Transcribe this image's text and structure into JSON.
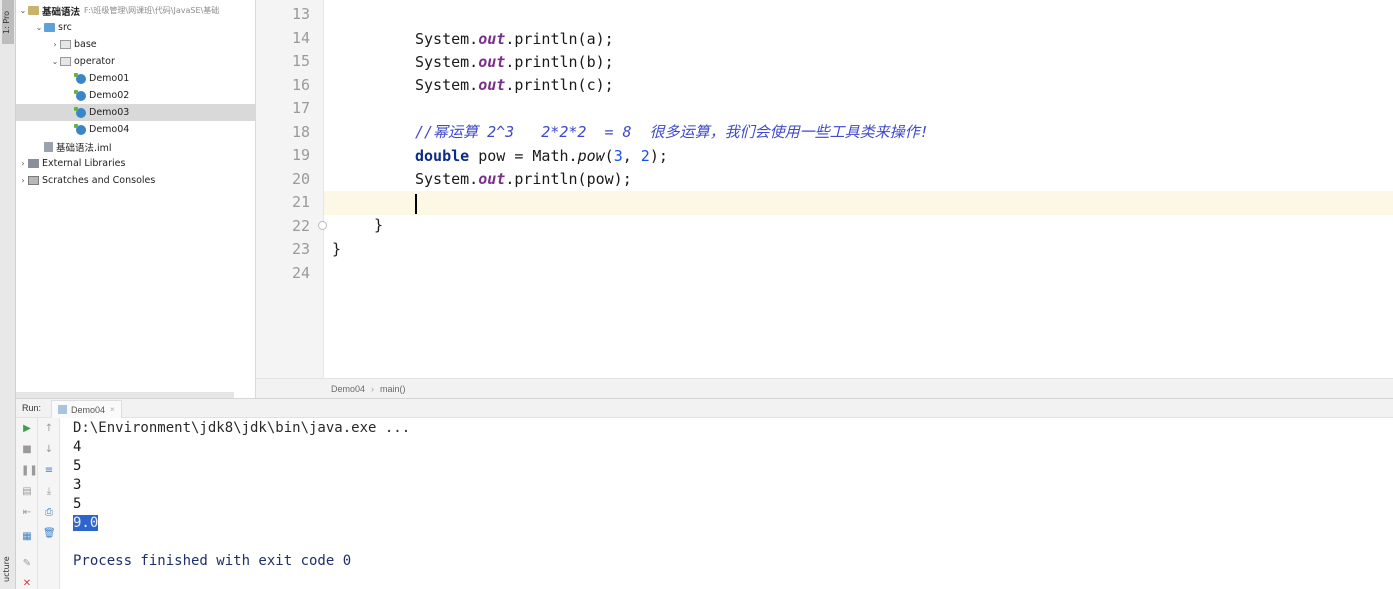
{
  "tool_strip": {
    "top_tab": "1: Pro",
    "bottom_tab": "ucture"
  },
  "project": {
    "items": [
      {
        "label": "基础语法",
        "hint": "F:\\班级管理\\网课班\\代码\\JavaSE\\基础",
        "indent": 0,
        "arrow": "v",
        "icon": "folder"
      },
      {
        "label": "src",
        "indent": 1,
        "arrow": "v",
        "icon": "src"
      },
      {
        "label": "base",
        "indent": 2,
        "arrow": ">",
        "icon": "pkg"
      },
      {
        "label": "operator",
        "indent": 2,
        "arrow": "v",
        "icon": "pkg"
      },
      {
        "label": "Demo01",
        "indent": 3,
        "arrow": "",
        "icon": "class"
      },
      {
        "label": "Demo02",
        "indent": 3,
        "arrow": "",
        "icon": "class"
      },
      {
        "label": "Demo03",
        "indent": 3,
        "arrow": "",
        "icon": "class",
        "selected": true
      },
      {
        "label": "Demo04",
        "indent": 3,
        "arrow": "",
        "icon": "class"
      },
      {
        "label": "基础语法.iml",
        "indent": 1,
        "arrow": "",
        "icon": "iml"
      },
      {
        "label": "External Libraries",
        "indent": 0,
        "arrow": ">",
        "icon": "lib"
      },
      {
        "label": "Scratches and Consoles",
        "indent": 0,
        "arrow": ">",
        "icon": "scratch"
      }
    ]
  },
  "editor": {
    "line_numbers": [
      "13",
      "14",
      "15",
      "16",
      "17",
      "18",
      "19",
      "20",
      "21",
      "22",
      "23",
      "24"
    ],
    "code": {
      "l14": {
        "pre": "System.",
        "field": "out",
        "post": ".println(a);"
      },
      "l15": {
        "pre": "System.",
        "field": "out",
        "post": ".println(b);"
      },
      "l16": {
        "pre": "System.",
        "field": "out",
        "post": ".println(c);"
      },
      "l18_comment": "//幂运算 2^3   2*2*2  = 8  很多运算，我们会使用一些工具类来操作!",
      "l19": {
        "kw": "double",
        "mid": " pow = Math.",
        "method": "pow",
        "open": "(",
        "n1": "3",
        "comma": ", ",
        "n2": "2",
        "close": ");"
      },
      "l20": {
        "pre": "System.",
        "field": "out",
        "post": ".println(pow);"
      },
      "l22": "}",
      "l23": "}"
    },
    "breadcrumb": {
      "class_name": "Demo04",
      "sep": "›",
      "method": "main()"
    }
  },
  "run": {
    "label": "Run:",
    "tab": "Demo04",
    "tab_close": "×",
    "output": {
      "command": "D:\\Environment\\jdk8\\jdk\\bin\\java.exe ...",
      "values": [
        "4",
        "5",
        "3",
        "5"
      ],
      "selected_value": "9.0",
      "finished": "Process finished with exit code 0"
    }
  }
}
